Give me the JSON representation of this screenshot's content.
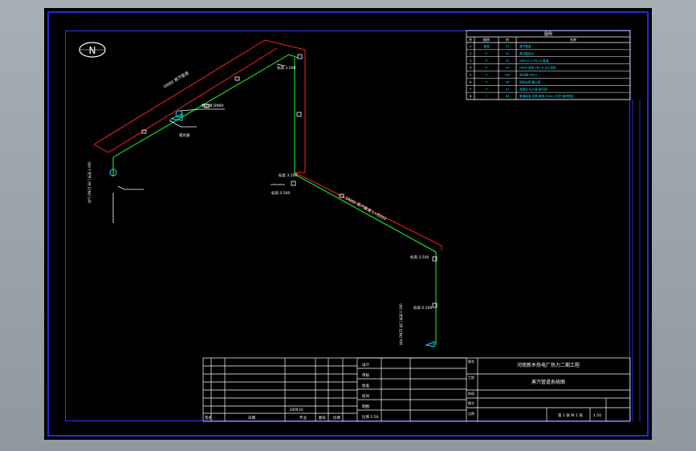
{
  "north_marker": {
    "letter": "N"
  },
  "legend": {
    "title": "图例",
    "headers": [
      "序",
      "图例",
      "符",
      "名称"
    ],
    "rows": [
      {
        "no": "1",
        "sym": "管道",
        "code": "S1",
        "desc": "蒸汽管道"
      },
      {
        "no": "2",
        "sym": "P",
        "code": "S2",
        "desc": "蒸汽凝结水"
      },
      {
        "no": "3",
        "sym": "P",
        "code": "S3",
        "desc": "Ø89×4.0 PN1.6 管道"
      },
      {
        "no": "4",
        "sym": "P",
        "code": "S4",
        "desc": "DN80 闸阀 PN1.6 法兰连接"
      },
      {
        "no": "5",
        "sym": "V",
        "code": "S5a",
        "desc": "疏水器 DN25"
      },
      {
        "no": "6",
        "sym": "V",
        "code": "S6",
        "desc": "固定支架 截止阀"
      },
      {
        "no": "7",
        "sym": "T",
        "code": "S7",
        "desc": "温度计 压力表 排气阀"
      },
      {
        "no": "8",
        "sym": "I",
        "code": "S8",
        "desc": "管道保温 岩棉 厚度 50mm 外护 镀锌铁皮"
      }
    ]
  },
  "pipe_labels": {
    "top_run": "DN80 蒸汽管道",
    "diag_run": "DN80 蒸汽管道 L=8000",
    "node_a": "标高 3.500",
    "node_b": "标高 3.500",
    "node_c": "标高 0.500",
    "node_d": "标高 3.500",
    "node_e": "标高 0.500",
    "valve_a": "截止阀 DN80",
    "valve_b": "疏水器",
    "note_left": "排气 DN15 阀门 标高 1.000",
    "note_right": "排水 DN25 阀门 标高 0.300"
  },
  "title_block": {
    "project_line1": "河南新乡热电厂热力二期工程",
    "project_line2": "蒸汽管道系统图",
    "row_labels": [
      "设计",
      "审核",
      "批准",
      "校对",
      "制图",
      "比例 1:50"
    ],
    "left_bottom": [
      "签名",
      "日期",
      "专业",
      "图号",
      "比例"
    ],
    "right_labels": [
      "图名",
      "工程",
      "阶段",
      "图号",
      "比例"
    ],
    "sheet_no": "第 1 张 共 1 张",
    "scale": "1:50",
    "date": "2009.10"
  },
  "colors": {
    "frame_blue": "#1f2bd8",
    "red_line": "#ff2020",
    "green_line": "#22ff22",
    "cyan_text": "#00e5ff",
    "white": "#ffffff"
  }
}
